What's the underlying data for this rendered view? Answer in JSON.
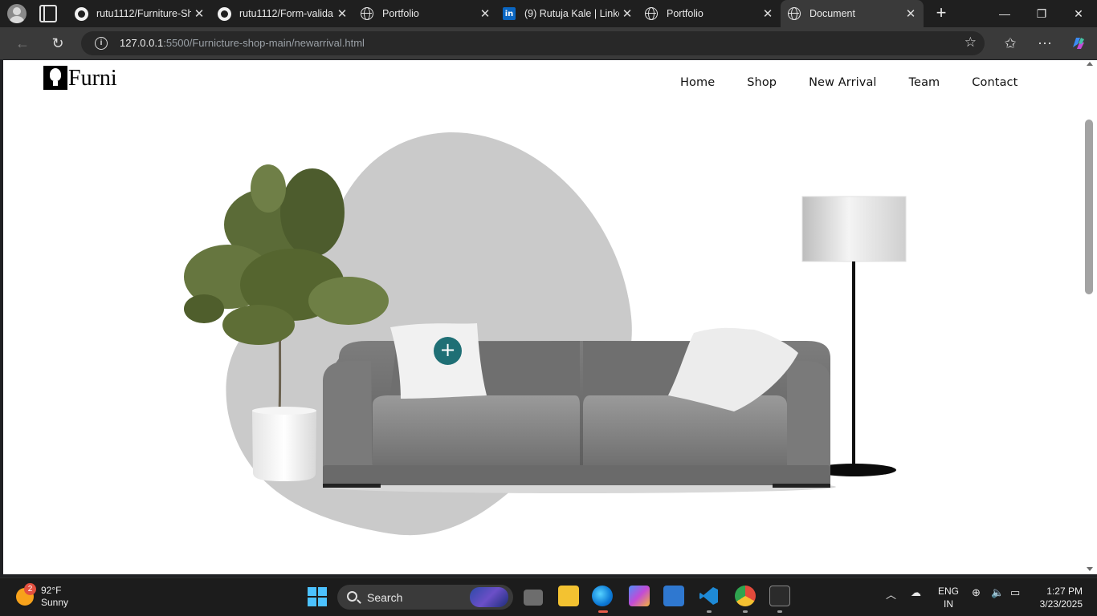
{
  "browser": {
    "tabs": [
      {
        "title": "rutu1112/Furniture-Sh",
        "icon": "github-icon"
      },
      {
        "title": "rutu1112/Form-valida",
        "icon": "github-icon"
      },
      {
        "title": "Portfolio",
        "icon": "globe-icon"
      },
      {
        "title": "(9) Rutuja Kale | Linke",
        "icon": "linkedin-icon"
      },
      {
        "title": "Portfolio",
        "icon": "globe-icon"
      },
      {
        "title": "Document",
        "icon": "globe-icon",
        "active": true
      }
    ],
    "url_host": "127.0.0.1",
    "url_path": ":5500/Furnicture-shop-main/newarrival.html"
  },
  "page": {
    "logo_text": "Furni",
    "nav": [
      "Home",
      "Shop",
      "New Arrival",
      "Team",
      "Contact"
    ],
    "hotspot_label": "+",
    "colors": {
      "accent": "#1f6f75",
      "blob": "#cacaca"
    }
  },
  "taskbar": {
    "weather_badge": "2",
    "temperature": "92°F",
    "condition": "Sunny",
    "search_label": "Search",
    "lang_top": "ENG",
    "lang_bottom": "IN",
    "time": "1:27 PM",
    "date": "3/23/2025"
  }
}
